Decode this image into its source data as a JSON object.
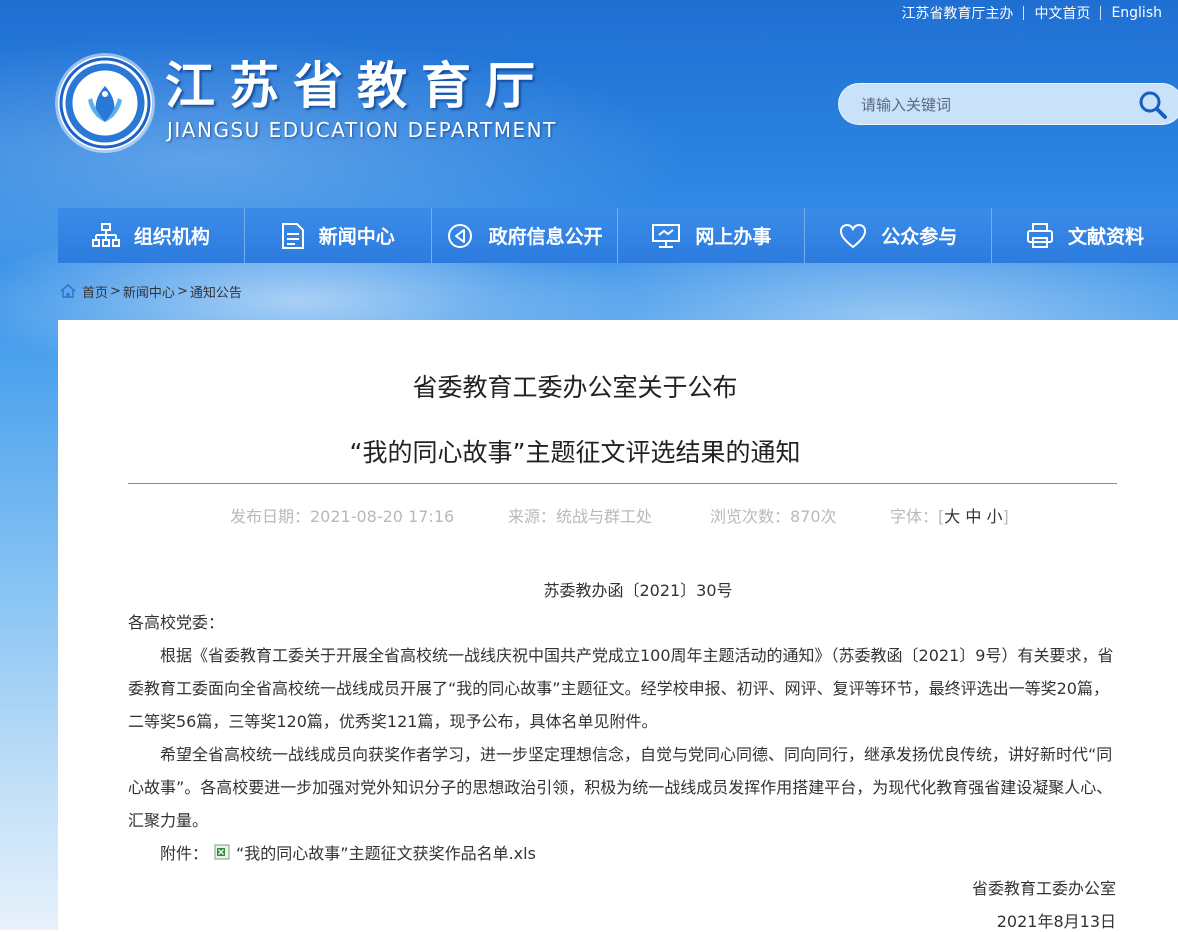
{
  "top_links": [
    "江苏省教育厅主办",
    "中文首页",
    "English"
  ],
  "logo": {
    "title_cn": "江苏省教育厅",
    "title_en": "JIANGSU EDUCATION DEPARTMENT",
    "emblem_icon": "jiangsu-education-emblem"
  },
  "search": {
    "placeholder": "请输入关键词",
    "icon": "search-icon"
  },
  "nav": [
    {
      "label": "组织机构",
      "icon": "org-chart-icon"
    },
    {
      "label": "新闻中心",
      "icon": "document-icon"
    },
    {
      "label": "政府信息公开",
      "icon": "speaker-icon"
    },
    {
      "label": "网上办事",
      "icon": "monitor-icon"
    },
    {
      "label": "公众参与",
      "icon": "heart-icon"
    },
    {
      "label": "文献资料",
      "icon": "printer-icon"
    }
  ],
  "breadcrumb": {
    "home": "首页",
    "sep": ">",
    "items": [
      "新闻中心",
      "通知公告"
    ]
  },
  "article": {
    "title_line1": "省委教育工委办公室关于公布",
    "title_line2": "“我的同心故事”主题征文评选结果的通知",
    "meta": {
      "date": "发布日期：2021-08-20 17:16",
      "source": "来源：统战与群工处",
      "views": "浏览次数：870次",
      "font_label": "字体：",
      "bracket_open": "[",
      "bracket_close": "]",
      "font_sizes": [
        "大",
        "中",
        "小"
      ]
    },
    "doc_number": "苏委教办函〔2021〕30号",
    "salutation": "各高校党委：",
    "paragraphs": [
      "根据《省委教育工委关于开展全省高校统一战线庆祝中国共产党成立100周年主题活动的通知》（苏委教函〔2021〕9号）有关要求，省委教育工委面向全省高校统一战线成员开展了“我的同心故事”主题征文。经学校申报、初评、网评、复评等环节，最终评选出一等奖20篇，二等奖56篇，三等奖120篇，优秀奖121篇，现予公布，具体名单见附件。",
      "希望全省高校统一战线成员向获奖作者学习，进一步坚定理想信念，自觉与党同心同德、同向同行，继承发扬优良传统，讲好新时代“同心故事”。各高校要进一步加强对党外知识分子的思想政治引领，积极为统一战线成员发挥作用搭建平台，为现代化教育强省建设凝聚人心、汇聚力量。"
    ],
    "attachment_label": "附件：",
    "attachment_icon": "excel-file-icon",
    "attachment_file": "“我的同心故事”主题征文获奖作品名单.xls",
    "signature": "省委教育工委办公室",
    "sign_date": "2021年8月13日"
  },
  "colors": {
    "nav_bg": "#2e7ee2",
    "header_top": "#1f6fd2",
    "meta_text": "#b9b9b9"
  }
}
